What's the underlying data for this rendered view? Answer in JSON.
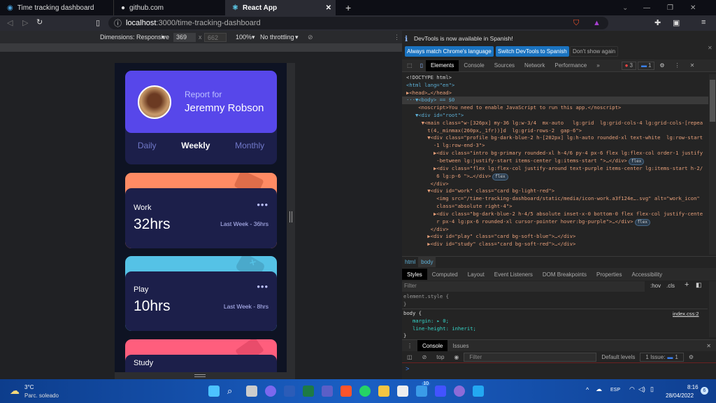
{
  "browser": {
    "tabs": [
      {
        "title": "Time tracking dashboard",
        "icon": "chat-icon"
      },
      {
        "title": "github.com",
        "icon": "github-icon"
      },
      {
        "title": "React App",
        "icon": "react-icon",
        "active": true
      }
    ],
    "url_host": "localhost",
    "url_path": ":3000/time-tracking-dashboard"
  },
  "device_toolbar": {
    "dimensions": "Dimensions: Responsive",
    "width": "369",
    "height": "662",
    "zoom": "100%",
    "throttling": "No throttling"
  },
  "app": {
    "report_for": "Report for",
    "name": "Jeremny Robson",
    "periods": [
      "Daily",
      "Weekly",
      "Monthly"
    ],
    "active_period": "Weekly",
    "cards": [
      {
        "title": "Work",
        "current": "32hrs",
        "previous": "Last Week - 36hrs",
        "color": "#ff8b64"
      },
      {
        "title": "Play",
        "current": "10hrs",
        "previous": "Last Week - 8hrs",
        "color": "#55c2e6"
      },
      {
        "title": "Study",
        "color": "#ff5e7d"
      }
    ]
  },
  "devtools": {
    "notice": "DevTools is now available in Spanish!",
    "btn_match": "Always match Chrome's language",
    "btn_switch": "Switch DevTools to Spanish",
    "btn_dont": "Don't show again",
    "tabs": [
      "Elements",
      "Console",
      "Sources",
      "Network",
      "Performance"
    ],
    "errors": "3",
    "messages": "1",
    "dom": [
      "<!DOCTYPE html>",
      "<html lang=\"en\">",
      "▶<head>…</head>",
      "···▼<body> == $0",
      "    <noscript>You need to enable JavaScript to run this app.</noscript>",
      "   ▼<div id=\"root\">",
      "     ▼<main class=\"w-[326px] my-36 lg:w-3/4  mx-auto   lg:grid  lg:grid-cols-4 lg:grid-cols-[repea",
      "       t(4,_minmax(260px,_1fr))]d  lg:grid-rows-2  gap-6\">",
      "       ▼<div class=\"profile bg-dark-blue-2 h-[202px] lg:h-auto rounded-xl text-white  lg:row-start",
      "         -1 lg:row-end-3\">",
      "         ▶<div class=\"intro bg-primary rounded-xl h-4/6 py-4 px-6 flex lg:flex-col order-1 justify",
      "          -between lg:justify-start items-center lg:items-start \">…</div>",
      "         ▶<div class=\"flex lg:flex-col justify-around text-purple items-center lg:items-start h-2/",
      "          6 lg:p-6 \">…</div>",
      "        </div>",
      "       ▼<div id=\"work\" class=\"card bg-light-red\">",
      "          <img src=\"/time-tracking-dashboard/static/media/icon-work.a3f124e….svg\" alt=\"work_icon\"",
      "          class=\"absolute right-4\">",
      "         ▶<div class=\"bg-dark-blue-2 h-4/5 absolute inset-x-0 bottom-0 flex flex-col justify-cente",
      "          r px-4 lg:px-6 rounded-xl cursor-pointer hover:bg-purple\">…</div>",
      "        </div>",
      "       ▶<div id=\"play\" class=\"card bg-soft-blue\">…</div>",
      "       ▶<div id=\"study\" class=\"card bg-soft-red\">…</div>"
    ],
    "flex_badge": "flex",
    "breadcrumb": [
      "html",
      "body"
    ],
    "style_tabs": [
      "Styles",
      "Computed",
      "Layout",
      "Event Listeners",
      "DOM Breakpoints",
      "Properties",
      "Accessibility"
    ],
    "filter_placeholder": "Filter",
    "hov": ":hov",
    "cls": ".cls",
    "element_style": "element.style {",
    "close_brace": "}",
    "body_rule": "body {",
    "body_source": "index.css:2",
    "margin": "margin: ▸ 0;",
    "line_height": "line-height: inherit;",
    "drawer_tabs": [
      "Console",
      "Issues"
    ],
    "context": "top",
    "console_filter": "Filter",
    "levels": "Default levels",
    "issues": "1 Issue:",
    "issues_count": "1",
    "prompt": ">"
  },
  "taskbar": {
    "temp": "3°C",
    "weather": "Parc. soleado",
    "lang": "ESP",
    "time": "8:16",
    "date": "28/04/2022",
    "notif": "6",
    "badge": "10"
  }
}
